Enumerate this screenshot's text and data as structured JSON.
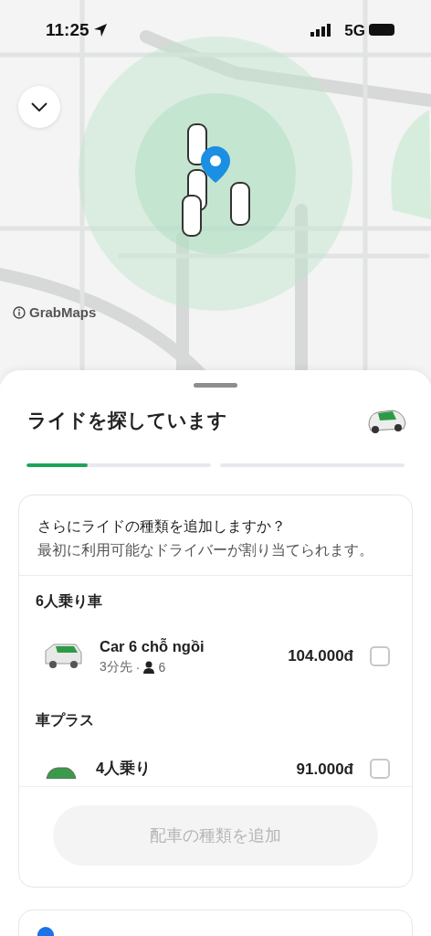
{
  "status_bar": {
    "time": "11:25",
    "network": "5G"
  },
  "map": {
    "attribution": "GrabMaps"
  },
  "sheet": {
    "title": "ライドを探しています",
    "progress": [
      {
        "level": 0.33
      },
      {
        "level": 0
      }
    ]
  },
  "ride_card": {
    "heading": "さらにライドの種類を追加しますか？",
    "subheading": "最初に利用可能なドライバーが割り当てられます。",
    "sections": [
      {
        "title": "6人乗り車",
        "options": [
          {
            "kind": "van",
            "name": "Car 6 chỗ ngồi",
            "eta": "3分先",
            "separator": "·",
            "seats": "6",
            "price": "104.000đ",
            "checked": false
          }
        ]
      },
      {
        "title": "車プラス",
        "options": [
          {
            "kind": "car",
            "name": "4人乗り",
            "price": "91.000đ",
            "checked": false
          }
        ]
      }
    ],
    "add_button": {
      "label": "配車の種類を追加",
      "disabled": true
    }
  }
}
